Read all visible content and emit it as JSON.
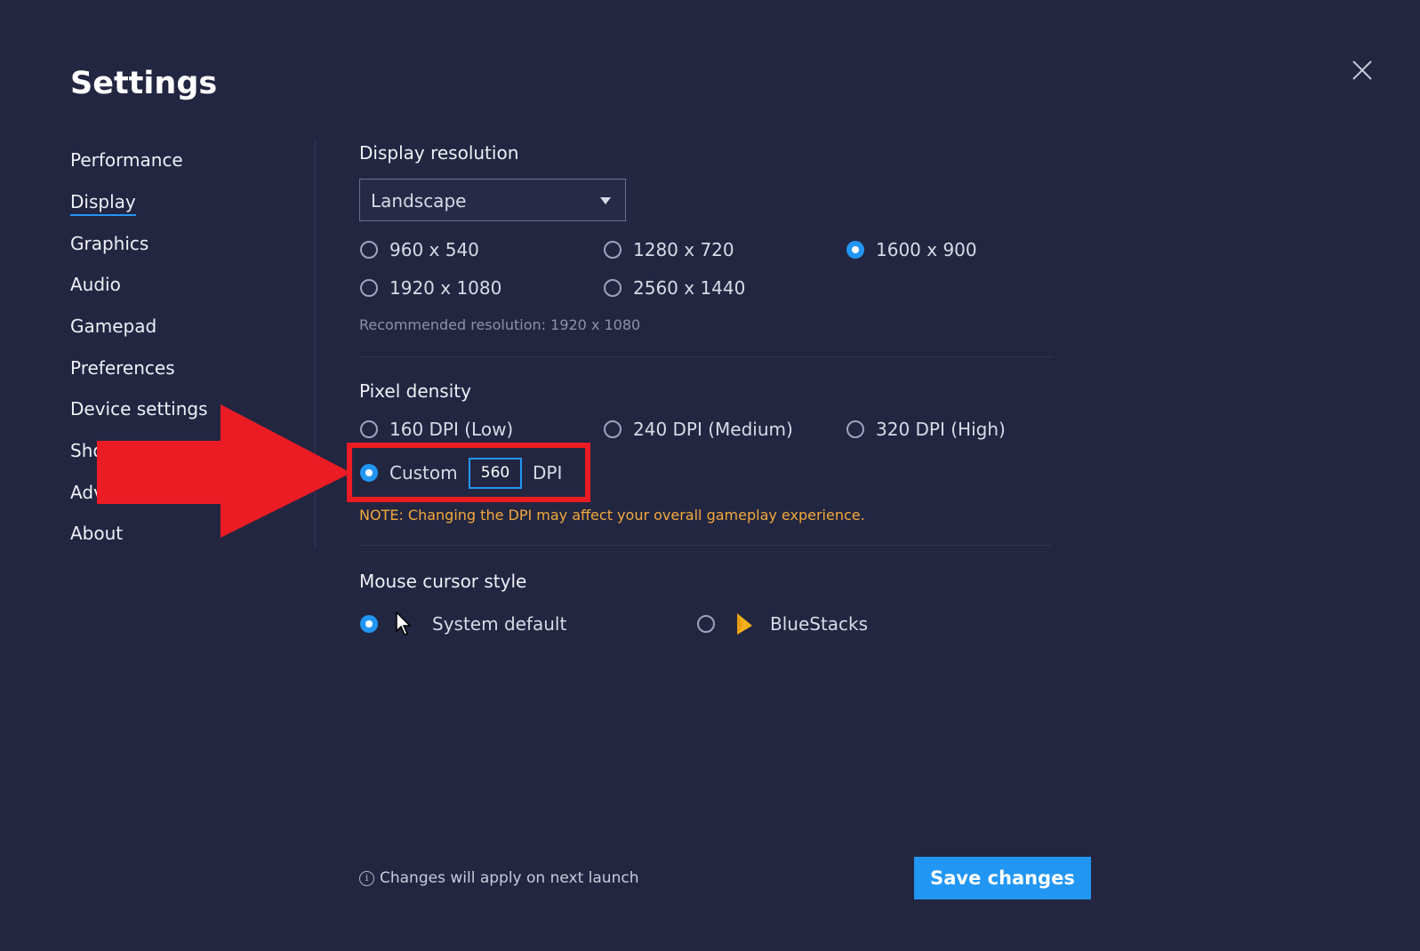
{
  "title": "Settings",
  "sidebar": {
    "items": [
      {
        "label": "Performance"
      },
      {
        "label": "Display"
      },
      {
        "label": "Graphics"
      },
      {
        "label": "Audio"
      },
      {
        "label": "Gamepad"
      },
      {
        "label": "Preferences"
      },
      {
        "label": "Device settings"
      },
      {
        "label": "Sho"
      },
      {
        "label": "Adv"
      },
      {
        "label": "About"
      }
    ],
    "active": "Display"
  },
  "display_resolution": {
    "title": "Display resolution",
    "orientation": "Landscape",
    "options": [
      {
        "label": "960 x 540",
        "selected": false
      },
      {
        "label": "1280 x 720",
        "selected": false
      },
      {
        "label": "1600 x 900",
        "selected": true
      },
      {
        "label": "1920 x 1080",
        "selected": false
      },
      {
        "label": "2560 x 1440",
        "selected": false
      }
    ],
    "recommended": "Recommended resolution: 1920 x 1080"
  },
  "pixel_density": {
    "title": "Pixel density",
    "options": [
      {
        "label": "160 DPI (Low)",
        "selected": false
      },
      {
        "label": "240 DPI (Medium)",
        "selected": false
      },
      {
        "label": "320 DPI (High)",
        "selected": false
      },
      {
        "label": "Custom",
        "selected": true
      }
    ],
    "custom_value": "560",
    "unit": "DPI",
    "note": "NOTE: Changing the DPI may affect your overall gameplay experience."
  },
  "mouse_cursor": {
    "title": "Mouse cursor style",
    "options": [
      {
        "label": "System default",
        "selected": true,
        "icon": "arrow-cursor-icon"
      },
      {
        "label": "BlueStacks",
        "selected": false,
        "icon": "bluestacks-cursor-icon"
      }
    ]
  },
  "footer": {
    "info_text": "Changes will apply on next launch",
    "info_icon": "i",
    "save_label": "Save changes"
  },
  "colors": {
    "background": "#232641",
    "accent": "#2196f3",
    "note": "#f3a93b",
    "annotation": "#ec1c24"
  }
}
